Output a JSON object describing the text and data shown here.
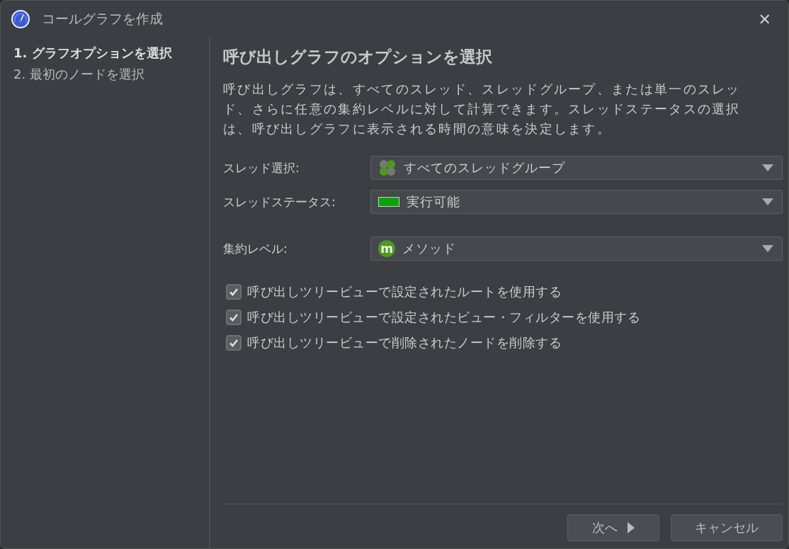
{
  "window": {
    "title": "コールグラフを作成",
    "close": "✕"
  },
  "steps": [
    {
      "label": "1. グラフオプションを選択",
      "selected": true
    },
    {
      "label": "2. 最初のノードを選択",
      "selected": false
    }
  ],
  "heading": "呼び出しグラフのオプションを選択",
  "description": "呼び出しグラフは、すべてのスレッド、スレッドグループ、または単一のスレッド、さらに任意の集約レベルに対して計算できます。スレッドステータスの選択は、呼び出しグラフに表示される時間の意味を決定します。",
  "fields": [
    {
      "label": "スレッド選択:",
      "value": "すべてのスレッドグループ",
      "kind": "threads"
    },
    {
      "label": "スレッドステータス:",
      "value": "実行可能",
      "kind": "status"
    },
    {
      "label": "集約レベル:",
      "value": "メソッド",
      "kind": "method",
      "icon_text": "m"
    }
  ],
  "options": [
    {
      "label": "呼び出しツリービューで設定されたルートを使用する",
      "checked": true
    },
    {
      "label": "呼び出しツリービューで設定されたビュー・フィルターを使用する",
      "checked": true
    },
    {
      "label": "呼び出しツリービューで削除されたノードを削除する",
      "checked": true
    }
  ],
  "buttons": [
    {
      "label": "次へ",
      "kind": "next"
    },
    {
      "label": "キャンセル",
      "kind": "cancel"
    }
  ]
}
